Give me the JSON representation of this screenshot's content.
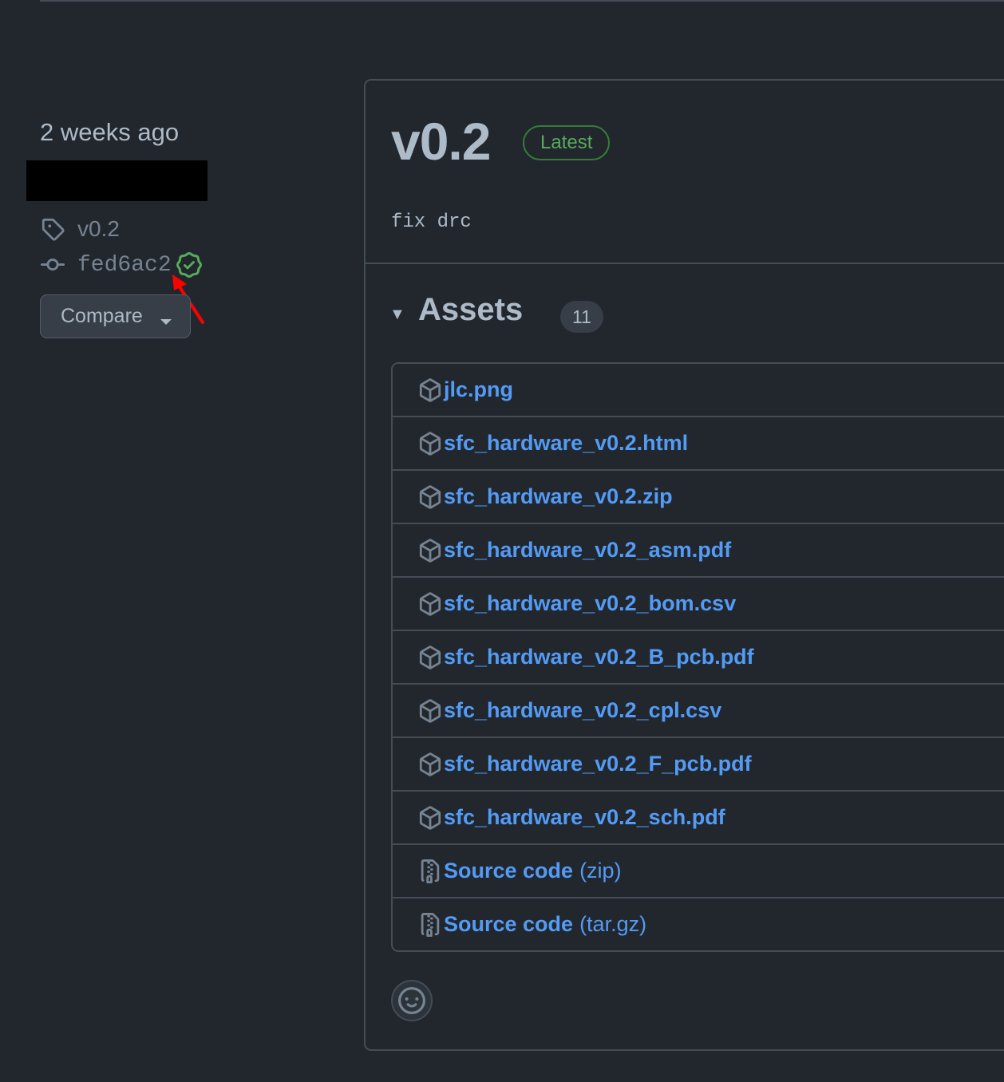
{
  "sidebar": {
    "time_ago": "2 weeks ago",
    "tag": "v0.2",
    "commit": "fed6ac2",
    "compare_label": "Compare"
  },
  "release": {
    "title": "v0.2",
    "badge": "Latest",
    "body": "fix drc",
    "assets_title": "Assets",
    "assets_count": "11",
    "assets": [
      {
        "name": "jlc.png",
        "icon": "package-icon"
      },
      {
        "name": "sfc_hardware_v0.2.html",
        "icon": "package-icon"
      },
      {
        "name": "sfc_hardware_v0.2.zip",
        "icon": "package-icon"
      },
      {
        "name": "sfc_hardware_v0.2_asm.pdf",
        "icon": "package-icon"
      },
      {
        "name": "sfc_hardware_v0.2_bom.csv",
        "icon": "package-icon"
      },
      {
        "name": "sfc_hardware_v0.2_B_pcb.pdf",
        "icon": "package-icon"
      },
      {
        "name": "sfc_hardware_v0.2_cpl.csv",
        "icon": "package-icon"
      },
      {
        "name": "sfc_hardware_v0.2_F_pcb.pdf",
        "icon": "package-icon"
      },
      {
        "name": "sfc_hardware_v0.2_sch.pdf",
        "icon": "package-icon"
      },
      {
        "name": "Source code",
        "suffix": "(zip)",
        "icon": "file-zip-icon"
      },
      {
        "name": "Source code",
        "suffix": "(tar.gz)",
        "icon": "file-zip-icon"
      }
    ]
  },
  "colors": {
    "background": "#22272e",
    "link": "#539bf5",
    "success": "#57ab5a",
    "annotation_arrow": "#ff0000"
  }
}
